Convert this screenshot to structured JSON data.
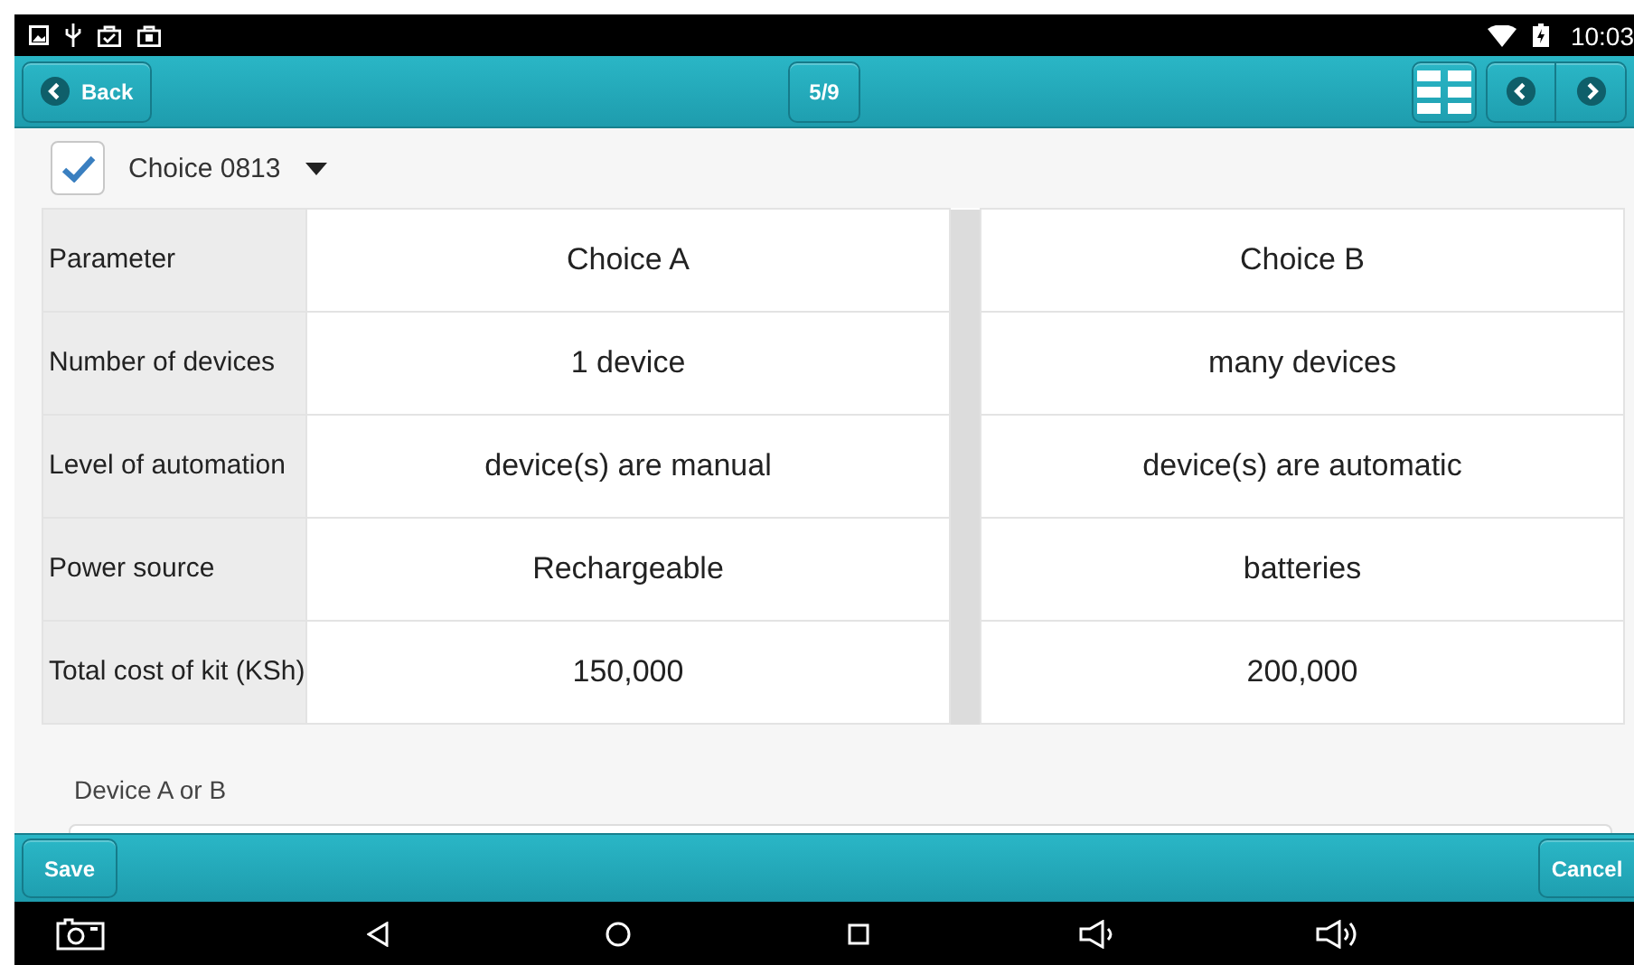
{
  "status_bar": {
    "time": "10:03"
  },
  "header": {
    "back": "Back",
    "counter": "5/9"
  },
  "choice": {
    "label": "Choice 0813",
    "checked": true
  },
  "table": {
    "rows": [
      {
        "parameter": "Parameter",
        "choice_a": "Choice A",
        "choice_b": "Choice B"
      },
      {
        "parameter": "Number of devices",
        "choice_a": "1 device",
        "choice_b": "many devices"
      },
      {
        "parameter": "Level of automation",
        "choice_a": "device(s) are manual",
        "choice_b": "device(s) are automatic"
      },
      {
        "parameter": "Power source",
        "choice_a": "Rechargeable",
        "choice_b": "batteries"
      },
      {
        "parameter": "Total cost of kit (KSh)",
        "choice_a": "150,000",
        "choice_b": "200,000"
      }
    ]
  },
  "question": {
    "label": "Device A or B"
  },
  "footer": {
    "save": "Save",
    "cancel": "Cancel"
  }
}
